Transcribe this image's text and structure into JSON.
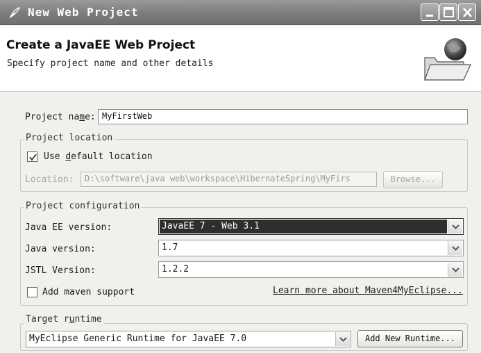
{
  "window": {
    "title": "New Web Project"
  },
  "header": {
    "title": "Create a JavaEE Web Project",
    "subtitle": "Specify project name and other details"
  },
  "project_name": {
    "label_pre": "Project na",
    "label_mnemonic": "m",
    "label_post": "e:",
    "value": "MyFirstWeb"
  },
  "project_location": {
    "group_title": "Project location",
    "use_default_pre": "Use ",
    "use_default_mnemonic": "d",
    "use_default_post": "efault location",
    "use_default_checked": true,
    "location_label": "Location:",
    "location_value": "D:\\software\\java web\\workspace\\HibernateSpring\\MyFirs",
    "browse_label": "Browse..."
  },
  "project_configuration": {
    "group_title": "Project configuration",
    "javaee_label": "Java EE version:",
    "javaee_value": "JavaEE 7 - Web 3.1",
    "java_label": "Java version:",
    "java_value": "1.7",
    "jstl_label": "JSTL Version:",
    "jstl_value": "1.2.2",
    "maven_label": "Add maven support",
    "maven_checked": false,
    "maven_link": "Learn more about Maven4MyEclipse..."
  },
  "target_runtime": {
    "group_title_pre": "Target r",
    "group_title_mnemonic": "u",
    "group_title_post": "ntime",
    "value": "MyEclipse Generic Runtime for JavaEE 7.0",
    "add_button": "Add New Runtime..."
  },
  "icons": {
    "app": "eclipse-feather-icon",
    "banner": "folder-globe-icon",
    "checkmark": "checkmark-icon",
    "dropdown": "chevron-down-icon"
  }
}
